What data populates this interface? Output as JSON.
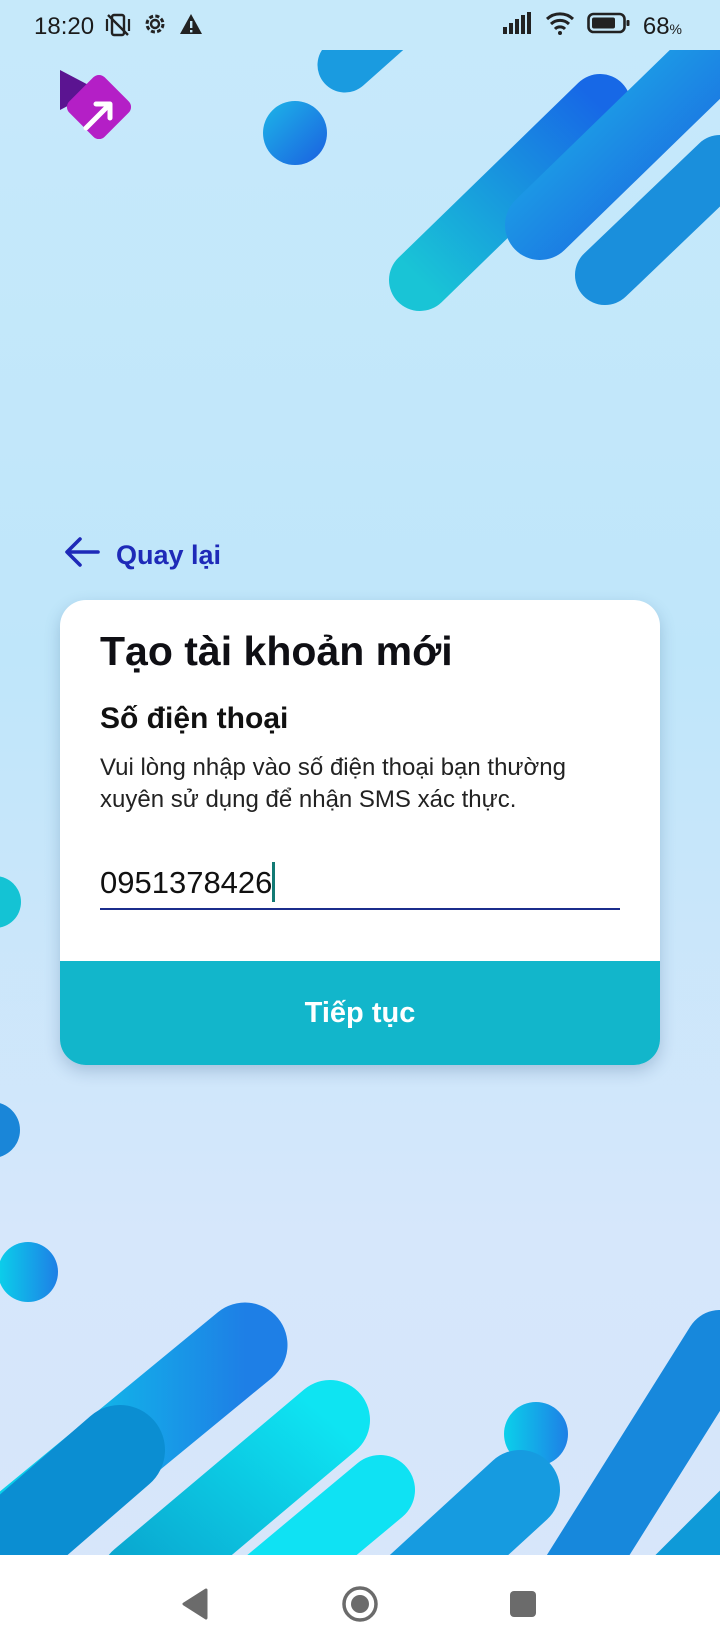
{
  "status_bar": {
    "time": "18:20",
    "battery_percent": "68",
    "battery_unit": "%",
    "icons": [
      "vibrate-off-icon",
      "gear-icon",
      "warning-icon",
      "signal-icon",
      "wifi-icon",
      "battery-icon"
    ]
  },
  "app": {
    "logo_icon": "app-logo-icon"
  },
  "back": {
    "label": "Quay lại",
    "icon": "arrow-left-icon"
  },
  "card": {
    "title": "Tạo tài khoản mới",
    "field_label": "Số điện thoại",
    "description": "Vui lòng nhập vào số điện thoại bạn thường xuyên sử dụng để nhận SMS xác thực.",
    "phone_value": "0951378426",
    "continue_label": "Tiếp tục"
  },
  "nav_bar": {
    "icons": [
      "back-triangle-icon",
      "home-circle-icon",
      "recents-square-icon"
    ]
  },
  "colors": {
    "accent": "#12b6cb",
    "link": "#1e2ab8",
    "input_underline": "#1b2d8c",
    "logo": "#b21fc4",
    "decor_blue": "#1f7ae6",
    "decor_cyan": "#15c7d6"
  }
}
